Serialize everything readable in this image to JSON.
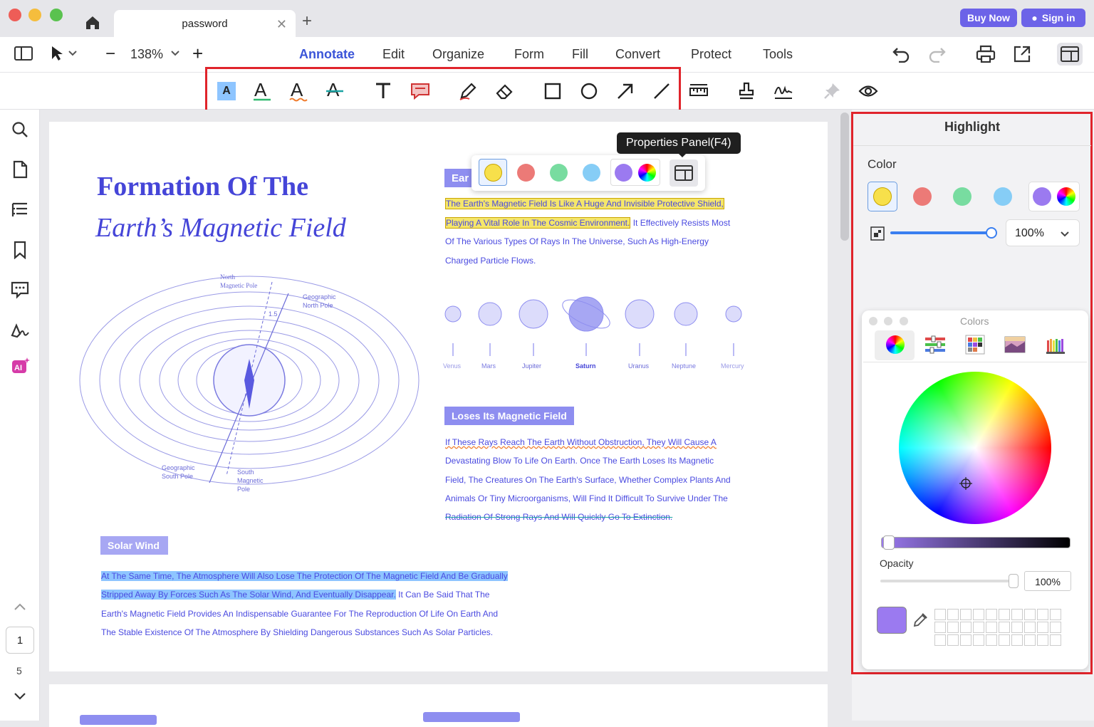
{
  "window": {
    "tab_title": "password"
  },
  "header": {
    "buy_now": "Buy Now",
    "sign_in": "Sign in"
  },
  "toolbar": {
    "zoom": "138%"
  },
  "menu": [
    "Annotate",
    "Edit",
    "Organize",
    "Form",
    "Fill",
    "Convert",
    "Protect",
    "Tools"
  ],
  "tooltip": "Properties Panel(F4)",
  "document": {
    "title1": "Formation Of The",
    "title2": "Earth’s Magnetic Field",
    "section_ear": "Ear",
    "para1": [
      "The Earth's Magnetic Field Is Like A Huge And Invisible Protective Shield,",
      "Playing A Vital Role In The Cosmic Environment.",
      " It Effectively Resists Most",
      "Of The Various Types Of Rays In The Universe, Such As High-Energy",
      "Charged Particle Flows."
    ],
    "diagram_labels": {
      "north_magnetic": "North\nMagnetic Pole",
      "geo_north": "Geographic\nNorth Pole",
      "angle": "1.5",
      "geo_south": "Geographic\nSouth Pole",
      "south_magnetic": "South\nMagnetic\nPole"
    },
    "planets": [
      "Venus",
      "Mars",
      "Jupiter",
      "Saturn",
      "Uranus",
      "Neptune",
      "Mercury"
    ],
    "section_loses": "Loses Its Magnetic Field",
    "para2": [
      "If These Rays Reach The Earth Without Obstruction, They Will Cause A",
      "Devastating Blow To Life On Earth. Once The Earth Loses Its Magnetic",
      "Field, The Creatures On The Earth's Surface, Whether Complex Plants And",
      "Animals Or Tiny Microorganisms, Will Find It Difficult To Survive Under The",
      "Radiation Of Strong Rays And Will Quickly Go To Extinction."
    ],
    "section_solar": "Solar Wind",
    "para3": [
      "At The Same Time, The Atmosphere Will Also Lose The Protection Of The Magnetic Field And Be Gradually",
      "Stripped Away By Forces Such As The Solar Wind, And Eventually Disappear.",
      " It Can Be Said That The",
      "Earth's Magnetic Field Provides An Indispensable Guarantee For The Reproduction Of Life On Earth And",
      "The Stable Existence Of The Atmosphere By Shielding Dangerous Substances Such As Solar Particles."
    ]
  },
  "pages": {
    "current": "1",
    "total": "5"
  },
  "panel": {
    "title": "Highlight",
    "color_label": "Color",
    "opacity_value": "100%"
  },
  "colors_dialog": {
    "title": "Colors",
    "opacity_label": "Opacity",
    "opacity_value": "100%"
  },
  "swatches": [
    "#f7e04b",
    "#ec7a77",
    "#78dca0",
    "#86cdf6",
    "#9b7af0"
  ]
}
